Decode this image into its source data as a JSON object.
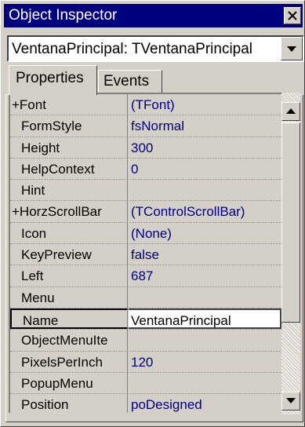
{
  "window": {
    "title": "Object Inspector",
    "close_icon": "close-icon"
  },
  "selector": {
    "value": "VentanaPrincipal: TVentanaPrincipal",
    "dropdown_icon": "chevron-down-icon"
  },
  "tabs": [
    {
      "label": "Properties",
      "active": true
    },
    {
      "label": "Events",
      "active": false
    }
  ],
  "properties": [
    {
      "name": "+Font",
      "value": "(TFont)",
      "indent": false
    },
    {
      "name": "FormStyle",
      "value": "fsNormal",
      "indent": true
    },
    {
      "name": "Height",
      "value": "300",
      "indent": true
    },
    {
      "name": "HelpContext",
      "value": "0",
      "indent": true
    },
    {
      "name": "Hint",
      "value": "",
      "indent": true
    },
    {
      "name": "+HorzScrollBar",
      "value": "(TControlScrollBar)",
      "indent": false
    },
    {
      "name": "Icon",
      "value": "(None)",
      "indent": true
    },
    {
      "name": "KeyPreview",
      "value": "false",
      "indent": true
    },
    {
      "name": "Left",
      "value": "687",
      "indent": true
    },
    {
      "name": "Menu",
      "value": "",
      "indent": true
    },
    {
      "name": "Name",
      "value": "VentanaPrincipal",
      "indent": true,
      "selected": true
    },
    {
      "name": "ObjectMenuIte",
      "value": "",
      "indent": true
    },
    {
      "name": "PixelsPerInch",
      "value": "120",
      "indent": true
    },
    {
      "name": "PopupMenu",
      "value": "",
      "indent": true
    },
    {
      "name": "Position",
      "value": "poDesigned",
      "indent": true
    }
  ],
  "colors": {
    "titlebar": "#000080",
    "value_text": "#000080",
    "face": "#d4d0c8"
  }
}
